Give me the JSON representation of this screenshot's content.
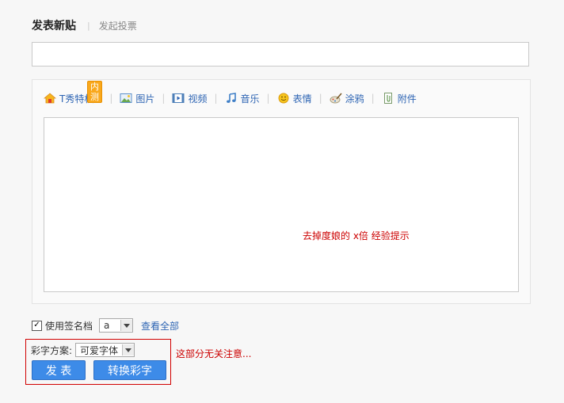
{
  "tabs": {
    "active": "发表新贴",
    "other": "发起投票"
  },
  "title_input": {
    "value": "",
    "placeholder": ""
  },
  "toolbar": {
    "tshow": {
      "label": "T秀特权",
      "badge": "内测",
      "icon": "house-icon"
    },
    "items": [
      {
        "label": "图片",
        "icon": "image-icon"
      },
      {
        "label": "视频",
        "icon": "video-icon"
      },
      {
        "label": "音乐",
        "icon": "music-icon"
      },
      {
        "label": "表情",
        "icon": "smiley-icon"
      },
      {
        "label": "涂鸦",
        "icon": "brush-icon"
      },
      {
        "label": "附件",
        "icon": "attachment-icon"
      }
    ]
  },
  "editor": {
    "hint": "去掉度娘的 x倍 经验提示"
  },
  "signature": {
    "checked": true,
    "label": "使用签名档",
    "selected": "a",
    "view_all": "查看全部"
  },
  "colorful_text": {
    "label": "彩字方案:",
    "selected": "可爱字体"
  },
  "note": "这部分无关注意...",
  "buttons": {
    "post": "发 表",
    "convert": "转换彩字"
  },
  "colors": {
    "link": "#2d64b3",
    "button": "#3d8be8",
    "highlight": "#cc0000"
  }
}
